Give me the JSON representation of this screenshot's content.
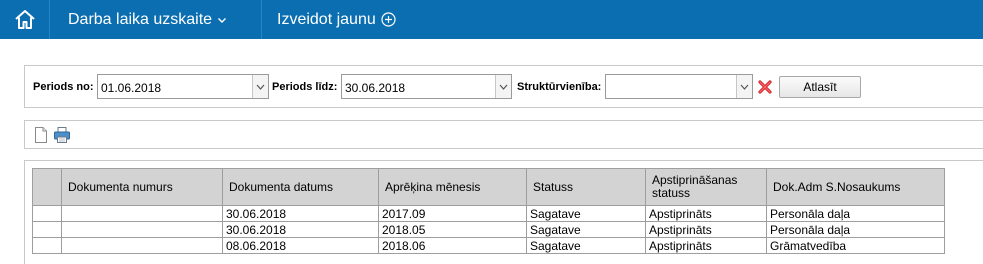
{
  "nav": {
    "home_icon": "home-icon",
    "menu_label": "Darba laika uzskaite",
    "create_label": "Izveidot jaunu"
  },
  "filter": {
    "period_from_label": "Periods no:",
    "period_from_value": "01.06.2018",
    "period_to_label": "Periods līdz:",
    "period_to_value": "30.06.2018",
    "unit_label": "Struktūrvienība:",
    "unit_value": "",
    "select_button": "Atlasīt"
  },
  "toolbar": {
    "new_icon": "new-document-icon",
    "print_icon": "print-icon"
  },
  "table": {
    "headers": [
      "",
      "Dokumenta numurs",
      "Dokumenta datums",
      "Aprēķina mēnesis",
      "Statuss",
      "Apstiprināšanas statuss",
      "Dok.Adm S.Nosaukums"
    ],
    "rows": [
      [
        "",
        "",
        "30.06.2018",
        "2017.09",
        "Sagatave",
        "Apstiprināts",
        "Personāla daļa"
      ],
      [
        "",
        "",
        "30.06.2018",
        "2018.05",
        "Sagatave",
        "Apstiprināts",
        "Personāla daļa"
      ],
      [
        "",
        "",
        "08.06.2018",
        "2018.06",
        "Sagatave",
        "Apstiprināts",
        "Grāmatvedība"
      ]
    ]
  },
  "colors": {
    "topbar": "#0a6eb1",
    "header_bg": "#d3d3d3",
    "clear_red": "#d9232a"
  }
}
